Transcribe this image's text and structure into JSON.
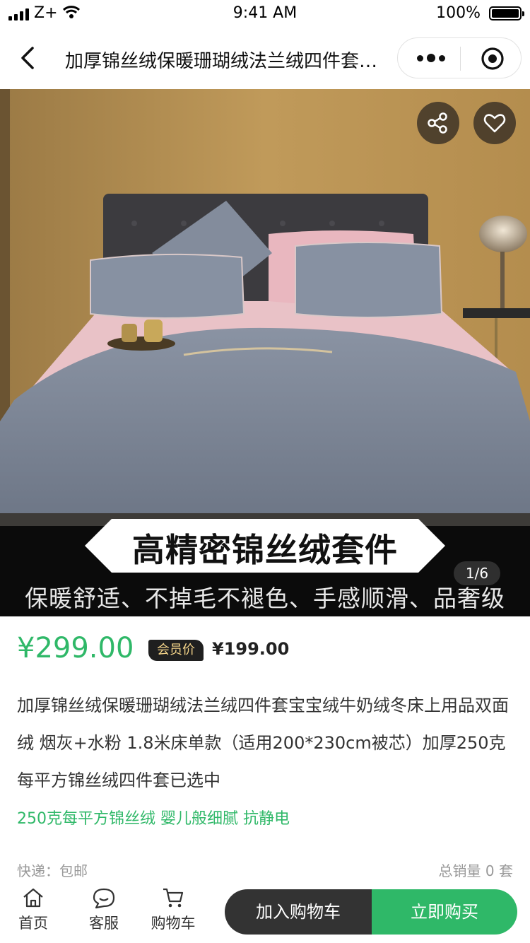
{
  "status_bar": {
    "carrier": "Z+",
    "time": "9:41 AM",
    "battery": "100%"
  },
  "nav": {
    "title": "加厚锦丝绒保暖珊瑚绒法兰绒四件套宝宝绒牛奶绒冬床上用品双面绒"
  },
  "gallery": {
    "banner_title": "高精密锦丝绒套件",
    "banner_subtitle": "保暖舒适、不掉毛不褪色、手感顺滑、品奢级",
    "counter": "1/6"
  },
  "product": {
    "price": "¥299.00",
    "member_tag": "会员价",
    "member_price": "¥199.00",
    "description": "加厚锦丝绒保暖珊瑚绒法兰绒四件套宝宝绒牛奶绒冬床上用品双面绒 烟灰+水粉 1.8米床单款（适用200*230cm被芯）加厚250克每平方锦丝绒四件套已选中",
    "selling_points": "250克每平方锦丝绒 婴儿般细腻 抗静电",
    "shipping": "快递：包邮",
    "sales": "总销量 0 套"
  },
  "bottom_bar": {
    "home": "首页",
    "service": "客服",
    "cart": "购物车",
    "add_to_cart": "加入购物车",
    "buy_now": "立即购买"
  },
  "colors": {
    "accent_green": "#2fb868",
    "dark": "#333333"
  }
}
